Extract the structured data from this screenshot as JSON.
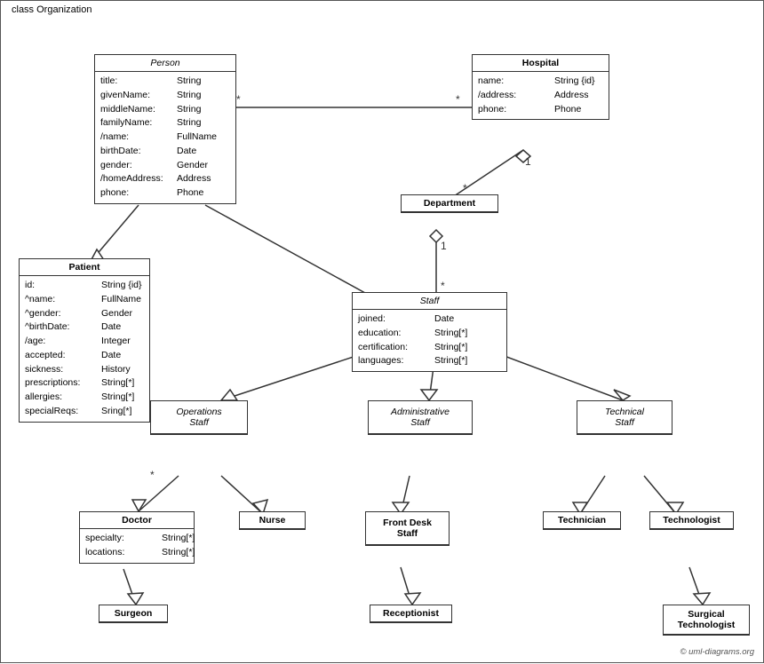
{
  "diagram_title": "class Organization",
  "copyright": "© uml-diagrams.org",
  "classes": {
    "person": {
      "name": "Person",
      "italic_header": true,
      "attributes": [
        {
          "name": "title:",
          "type": "String"
        },
        {
          "name": "givenName:",
          "type": "String"
        },
        {
          "name": "middleName:",
          "type": "String"
        },
        {
          "name": "familyName:",
          "type": "String"
        },
        {
          "name": "/name:",
          "type": "FullName"
        },
        {
          "name": "birthDate:",
          "type": "Date"
        },
        {
          "name": "gender:",
          "type": "Gender"
        },
        {
          "name": "/homeAddress:",
          "type": "Address"
        },
        {
          "name": "phone:",
          "type": "Phone"
        }
      ]
    },
    "hospital": {
      "name": "Hospital",
      "italic_header": false,
      "attributes": [
        {
          "name": "name:",
          "type": "String {id}"
        },
        {
          "name": "/address:",
          "type": "Address"
        },
        {
          "name": "phone:",
          "type": "Phone"
        }
      ]
    },
    "department": {
      "name": "Department",
      "italic_header": false,
      "attributes": []
    },
    "staff": {
      "name": "Staff",
      "italic_header": true,
      "attributes": [
        {
          "name": "joined:",
          "type": "Date"
        },
        {
          "name": "education:",
          "type": "String[*]"
        },
        {
          "name": "certification:",
          "type": "String[*]"
        },
        {
          "name": "languages:",
          "type": "String[*]"
        }
      ]
    },
    "patient": {
      "name": "Patient",
      "italic_header": false,
      "attributes": [
        {
          "name": "id:",
          "type": "String {id}"
        },
        {
          "name": "^name:",
          "type": "FullName"
        },
        {
          "name": "^gender:",
          "type": "Gender"
        },
        {
          "name": "^birthDate:",
          "type": "Date"
        },
        {
          "name": "/age:",
          "type": "Integer"
        },
        {
          "name": "accepted:",
          "type": "Date"
        },
        {
          "name": "sickness:",
          "type": "History"
        },
        {
          "name": "prescriptions:",
          "type": "String[*]"
        },
        {
          "name": "allergies:",
          "type": "String[*]"
        },
        {
          "name": "specialReqs:",
          "type": "Sring[*]"
        }
      ]
    },
    "operations_staff": {
      "name": "Operations Staff",
      "italic_header": true
    },
    "administrative_staff": {
      "name": "Administrative Staff",
      "italic_header": true
    },
    "technical_staff": {
      "name": "Technical Staff",
      "italic_header": true
    },
    "doctor": {
      "name": "Doctor",
      "italic_header": false,
      "attributes": [
        {
          "name": "specialty:",
          "type": "String[*]"
        },
        {
          "name": "locations:",
          "type": "String[*]"
        }
      ]
    },
    "nurse": {
      "name": "Nurse",
      "italic_header": false,
      "attributes": []
    },
    "front_desk_staff": {
      "name": "Front Desk Staff",
      "italic_header": false,
      "attributes": []
    },
    "technician": {
      "name": "Technician",
      "italic_header": false,
      "attributes": []
    },
    "technologist": {
      "name": "Technologist",
      "italic_header": false,
      "attributes": []
    },
    "surgeon": {
      "name": "Surgeon",
      "italic_header": false,
      "attributes": []
    },
    "receptionist": {
      "name": "Receptionist",
      "italic_header": false,
      "attributes": []
    },
    "surgical_technologist": {
      "name": "Surgical Technologist",
      "italic_header": false,
      "attributes": []
    }
  }
}
